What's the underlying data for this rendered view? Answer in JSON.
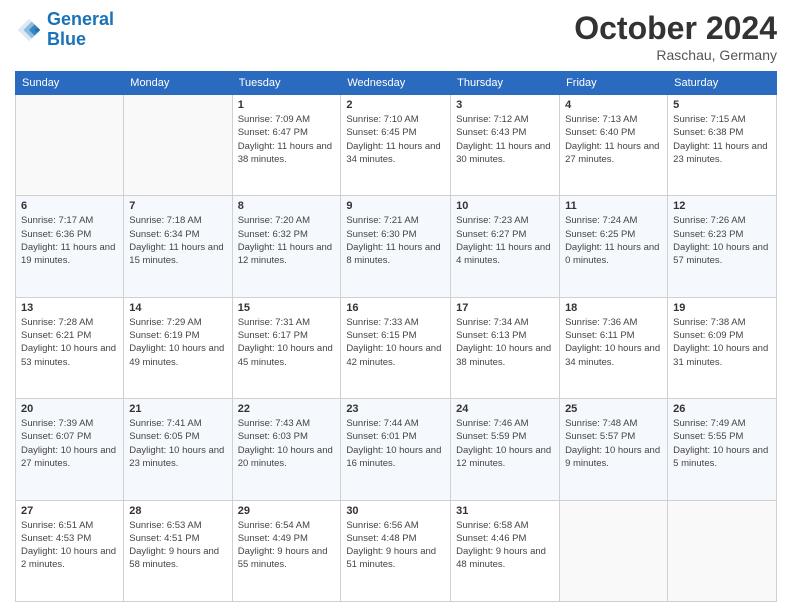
{
  "logo": {
    "line1": "General",
    "line2": "Blue"
  },
  "header": {
    "month": "October 2024",
    "location": "Raschau, Germany"
  },
  "weekdays": [
    "Sunday",
    "Monday",
    "Tuesday",
    "Wednesday",
    "Thursday",
    "Friday",
    "Saturday"
  ],
  "weeks": [
    [
      {
        "day": "",
        "sunrise": "",
        "sunset": "",
        "daylight": ""
      },
      {
        "day": "",
        "sunrise": "",
        "sunset": "",
        "daylight": ""
      },
      {
        "day": "1",
        "sunrise": "Sunrise: 7:09 AM",
        "sunset": "Sunset: 6:47 PM",
        "daylight": "Daylight: 11 hours and 38 minutes."
      },
      {
        "day": "2",
        "sunrise": "Sunrise: 7:10 AM",
        "sunset": "Sunset: 6:45 PM",
        "daylight": "Daylight: 11 hours and 34 minutes."
      },
      {
        "day": "3",
        "sunrise": "Sunrise: 7:12 AM",
        "sunset": "Sunset: 6:43 PM",
        "daylight": "Daylight: 11 hours and 30 minutes."
      },
      {
        "day": "4",
        "sunrise": "Sunrise: 7:13 AM",
        "sunset": "Sunset: 6:40 PM",
        "daylight": "Daylight: 11 hours and 27 minutes."
      },
      {
        "day": "5",
        "sunrise": "Sunrise: 7:15 AM",
        "sunset": "Sunset: 6:38 PM",
        "daylight": "Daylight: 11 hours and 23 minutes."
      }
    ],
    [
      {
        "day": "6",
        "sunrise": "Sunrise: 7:17 AM",
        "sunset": "Sunset: 6:36 PM",
        "daylight": "Daylight: 11 hours and 19 minutes."
      },
      {
        "day": "7",
        "sunrise": "Sunrise: 7:18 AM",
        "sunset": "Sunset: 6:34 PM",
        "daylight": "Daylight: 11 hours and 15 minutes."
      },
      {
        "day": "8",
        "sunrise": "Sunrise: 7:20 AM",
        "sunset": "Sunset: 6:32 PM",
        "daylight": "Daylight: 11 hours and 12 minutes."
      },
      {
        "day": "9",
        "sunrise": "Sunrise: 7:21 AM",
        "sunset": "Sunset: 6:30 PM",
        "daylight": "Daylight: 11 hours and 8 minutes."
      },
      {
        "day": "10",
        "sunrise": "Sunrise: 7:23 AM",
        "sunset": "Sunset: 6:27 PM",
        "daylight": "Daylight: 11 hours and 4 minutes."
      },
      {
        "day": "11",
        "sunrise": "Sunrise: 7:24 AM",
        "sunset": "Sunset: 6:25 PM",
        "daylight": "Daylight: 11 hours and 0 minutes."
      },
      {
        "day": "12",
        "sunrise": "Sunrise: 7:26 AM",
        "sunset": "Sunset: 6:23 PM",
        "daylight": "Daylight: 10 hours and 57 minutes."
      }
    ],
    [
      {
        "day": "13",
        "sunrise": "Sunrise: 7:28 AM",
        "sunset": "Sunset: 6:21 PM",
        "daylight": "Daylight: 10 hours and 53 minutes."
      },
      {
        "day": "14",
        "sunrise": "Sunrise: 7:29 AM",
        "sunset": "Sunset: 6:19 PM",
        "daylight": "Daylight: 10 hours and 49 minutes."
      },
      {
        "day": "15",
        "sunrise": "Sunrise: 7:31 AM",
        "sunset": "Sunset: 6:17 PM",
        "daylight": "Daylight: 10 hours and 45 minutes."
      },
      {
        "day": "16",
        "sunrise": "Sunrise: 7:33 AM",
        "sunset": "Sunset: 6:15 PM",
        "daylight": "Daylight: 10 hours and 42 minutes."
      },
      {
        "day": "17",
        "sunrise": "Sunrise: 7:34 AM",
        "sunset": "Sunset: 6:13 PM",
        "daylight": "Daylight: 10 hours and 38 minutes."
      },
      {
        "day": "18",
        "sunrise": "Sunrise: 7:36 AM",
        "sunset": "Sunset: 6:11 PM",
        "daylight": "Daylight: 10 hours and 34 minutes."
      },
      {
        "day": "19",
        "sunrise": "Sunrise: 7:38 AM",
        "sunset": "Sunset: 6:09 PM",
        "daylight": "Daylight: 10 hours and 31 minutes."
      }
    ],
    [
      {
        "day": "20",
        "sunrise": "Sunrise: 7:39 AM",
        "sunset": "Sunset: 6:07 PM",
        "daylight": "Daylight: 10 hours and 27 minutes."
      },
      {
        "day": "21",
        "sunrise": "Sunrise: 7:41 AM",
        "sunset": "Sunset: 6:05 PM",
        "daylight": "Daylight: 10 hours and 23 minutes."
      },
      {
        "day": "22",
        "sunrise": "Sunrise: 7:43 AM",
        "sunset": "Sunset: 6:03 PM",
        "daylight": "Daylight: 10 hours and 20 minutes."
      },
      {
        "day": "23",
        "sunrise": "Sunrise: 7:44 AM",
        "sunset": "Sunset: 6:01 PM",
        "daylight": "Daylight: 10 hours and 16 minutes."
      },
      {
        "day": "24",
        "sunrise": "Sunrise: 7:46 AM",
        "sunset": "Sunset: 5:59 PM",
        "daylight": "Daylight: 10 hours and 12 minutes."
      },
      {
        "day": "25",
        "sunrise": "Sunrise: 7:48 AM",
        "sunset": "Sunset: 5:57 PM",
        "daylight": "Daylight: 10 hours and 9 minutes."
      },
      {
        "day": "26",
        "sunrise": "Sunrise: 7:49 AM",
        "sunset": "Sunset: 5:55 PM",
        "daylight": "Daylight: 10 hours and 5 minutes."
      }
    ],
    [
      {
        "day": "27",
        "sunrise": "Sunrise: 6:51 AM",
        "sunset": "Sunset: 4:53 PM",
        "daylight": "Daylight: 10 hours and 2 minutes."
      },
      {
        "day": "28",
        "sunrise": "Sunrise: 6:53 AM",
        "sunset": "Sunset: 4:51 PM",
        "daylight": "Daylight: 9 hours and 58 minutes."
      },
      {
        "day": "29",
        "sunrise": "Sunrise: 6:54 AM",
        "sunset": "Sunset: 4:49 PM",
        "daylight": "Daylight: 9 hours and 55 minutes."
      },
      {
        "day": "30",
        "sunrise": "Sunrise: 6:56 AM",
        "sunset": "Sunset: 4:48 PM",
        "daylight": "Daylight: 9 hours and 51 minutes."
      },
      {
        "day": "31",
        "sunrise": "Sunrise: 6:58 AM",
        "sunset": "Sunset: 4:46 PM",
        "daylight": "Daylight: 9 hours and 48 minutes."
      },
      {
        "day": "",
        "sunrise": "",
        "sunset": "",
        "daylight": ""
      },
      {
        "day": "",
        "sunrise": "",
        "sunset": "",
        "daylight": ""
      }
    ]
  ]
}
